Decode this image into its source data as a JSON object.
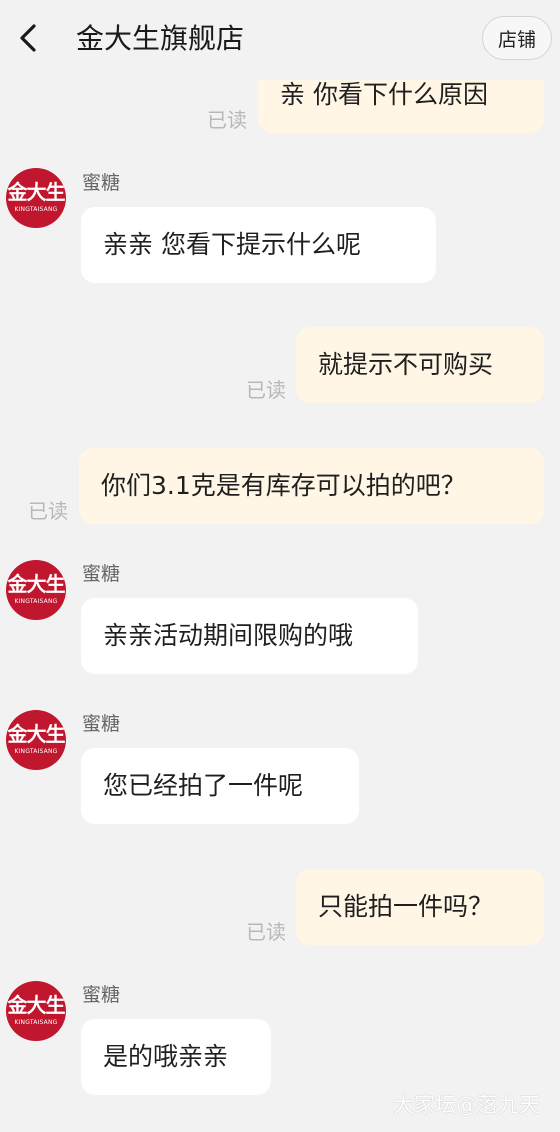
{
  "header": {
    "title": "金大生旗舰店",
    "store_button": "店铺"
  },
  "avatar": {
    "main_text": "金大生",
    "sub_text": "KINGTAISANG"
  },
  "messages": [
    {
      "side": "out",
      "text": "亲 你看下什么原因",
      "read": "已读"
    },
    {
      "side": "in",
      "sender": "蜜糖",
      "text": "亲亲  您看下提示什么呢"
    },
    {
      "side": "out",
      "text": "就提示不可购买",
      "read": "已读"
    },
    {
      "side": "out",
      "text": "你们3.1克是有库存可以拍的吧？",
      "read": "已读"
    },
    {
      "side": "in",
      "sender": "蜜糖",
      "text": "亲亲活动期间限购的哦"
    },
    {
      "side": "in",
      "sender": "蜜糖",
      "text": "您已经拍了一件呢"
    },
    {
      "side": "out",
      "text": "只能拍一件吗？",
      "read": "已读"
    },
    {
      "side": "in",
      "sender": "蜜糖",
      "text": "是的哦亲亲"
    }
  ],
  "watermark": "大家坛@落九天",
  "colors": {
    "background": "#f2f2f2",
    "outgoing_bubble": "#fff6e6",
    "incoming_bubble": "#ffffff",
    "avatar_brand": "#c0172e",
    "read_status": "#b8b8b8"
  },
  "icons": {
    "back": "chevron-left-icon"
  }
}
